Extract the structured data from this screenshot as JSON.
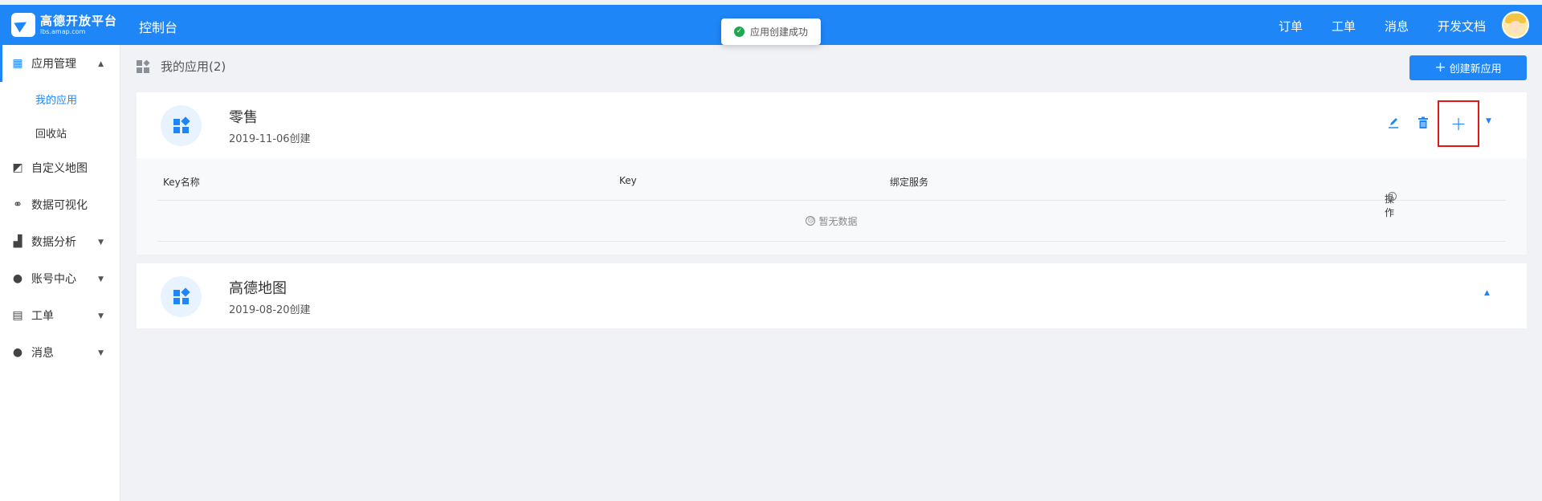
{
  "topbar": {
    "logo_title": "高德开放平台",
    "logo_sub": "lbs.amap.com",
    "console": "控制台",
    "nav": [
      "订单",
      "工单",
      "消息",
      "开发文档"
    ],
    "accent": "#1f86f7"
  },
  "toast": {
    "text": "应用创建成功",
    "icon": "check-circle-icon",
    "color": "#20a84f"
  },
  "sidebar": {
    "items": [
      {
        "label": "应用管理",
        "icon": "apps-icon",
        "caret": "▲",
        "subs": [
          "我的应用",
          "回收站"
        ]
      },
      {
        "label": "自定义地图",
        "icon": "map-icon"
      },
      {
        "label": "数据可视化",
        "icon": "data-viz-icon"
      },
      {
        "label": "数据分析",
        "icon": "chart-icon",
        "caret": "▼"
      },
      {
        "label": "账号中心",
        "icon": "user-icon",
        "caret": "▼"
      },
      {
        "label": "工单",
        "icon": "clipboard-icon",
        "caret": "▼"
      },
      {
        "label": "消息",
        "icon": "chat-icon",
        "caret": "▼"
      }
    ]
  },
  "page": {
    "title": "我的应用(2)",
    "create_label": "创建新应用"
  },
  "apps": [
    {
      "name": "零售",
      "date": "2019-11-06创建",
      "table": {
        "headers": [
          "Key名称",
          "Key",
          "绑定服务",
          "操作"
        ],
        "empty": "暂无数据"
      }
    },
    {
      "name": "高德地图",
      "date": "2019-08-20创建"
    }
  ],
  "highlight_color": "#e0161b"
}
